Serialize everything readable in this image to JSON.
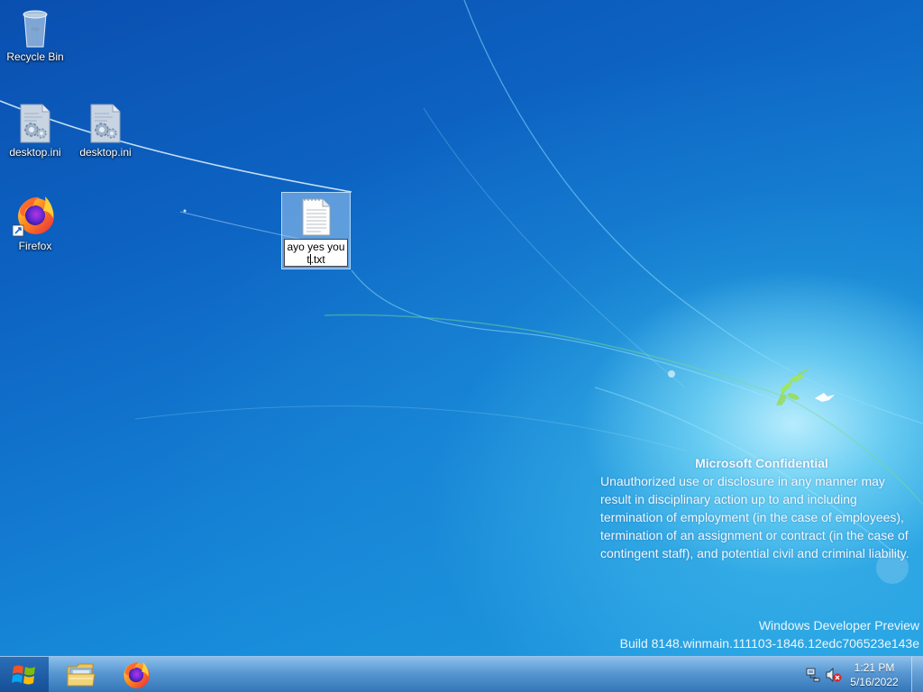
{
  "desktop": {
    "icons": [
      {
        "label": "Recycle Bin",
        "icon": "recycle-bin-icon"
      },
      {
        "label": "desktop.ini",
        "icon": "settings-file-icon"
      },
      {
        "label": "desktop.ini",
        "icon": "settings-file-icon"
      },
      {
        "label": "Firefox",
        "icon": "firefox-icon"
      }
    ],
    "renaming_file": {
      "icon": "text-file-icon",
      "name_before_caret": "ayo yes you t",
      "name_after_caret": ".txt"
    }
  },
  "watermark": {
    "title": "Microsoft Confidential",
    "body": "Unauthorized use or disclosure in any manner may result in disciplinary action up to and including termination of employment (in the case of employees), termination of an assignment or contract (in the case of contingent staff), and potential civil and criminal liability."
  },
  "build": {
    "line1": "Windows Developer Preview",
    "line2": "Build 8148.winmain.111103-1846.12edc706523e143e"
  },
  "taskbar": {
    "start_icon": "windows-logo-icon",
    "pinned": [
      {
        "name": "File Explorer",
        "icon": "file-explorer-icon"
      },
      {
        "name": "Firefox",
        "icon": "firefox-icon"
      }
    ],
    "tray": {
      "network_icon": "network-icon",
      "volume_icon": "volume-muted-icon"
    },
    "clock": {
      "time": "1:21 PM",
      "date": "5/16/2022"
    }
  },
  "colors": {
    "wallpaper_deep": "#0a4fb0",
    "wallpaper_glow": "#bef0ff",
    "selection": "#a0c8f0"
  }
}
